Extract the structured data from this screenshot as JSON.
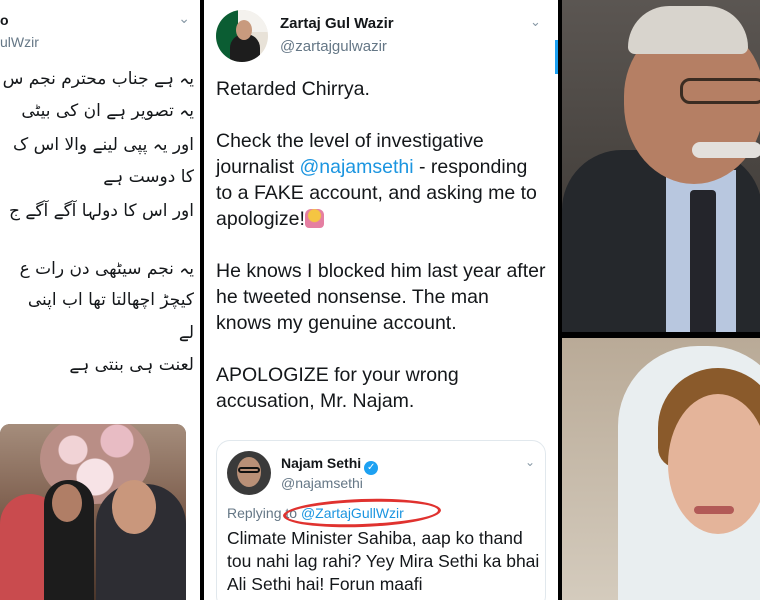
{
  "left_tweet": {
    "name": "o",
    "handle": "ulWzir",
    "lines": [
      "یہ ہے جناب محترم نجم س",
      "یہ تصویر ہے ان کی بیٹی",
      "اور یہ پپی لینے والا اس ک",
      "کا دوست ہے",
      "اور اس کا دولہا آگے آگے ج",
      "",
      "یہ نجم سیٹھی دن رات ع",
      "کیچڑ اچھالتا تھا اب اپنی",
      "لے",
      "لعنت ہی بنتی ہے"
    ]
  },
  "tweet": {
    "author_name": "Zartaj Gul Wazir",
    "author_handle": "@zartajgulwazir",
    "p1": "Retarded Chirrya.",
    "p2_before": "Check the level of investigative journalist ",
    "p2_mention": "@najamsethi",
    "p2_after": " - responding to a FAKE account, and asking me to apologize!",
    "p3": "He knows I blocked him last year after he tweeted nonsense. The man knows my genuine account.",
    "p4": "APOLOGIZE for your wrong accusation, Mr. Najam."
  },
  "quoted_tweet": {
    "name": "Najam Sethi",
    "handle": "@najamsethi",
    "replying_label": "Replying to ",
    "replying_to": "@ZartajGullWzir",
    "text": "Climate Minister Sahiba, aap ko thand tou nahi lag rahi? Yey Mira Sethi ka bhai Ali Sethi hai! Forun maafi"
  },
  "colors": {
    "twitter_blue": "#1da1f2",
    "mention": "#1b95e0",
    "highlight_circle": "#e0322f"
  },
  "icons": [
    "chevron-down-icon",
    "verified-badge-icon",
    "facepalm-emoji-icon"
  ]
}
